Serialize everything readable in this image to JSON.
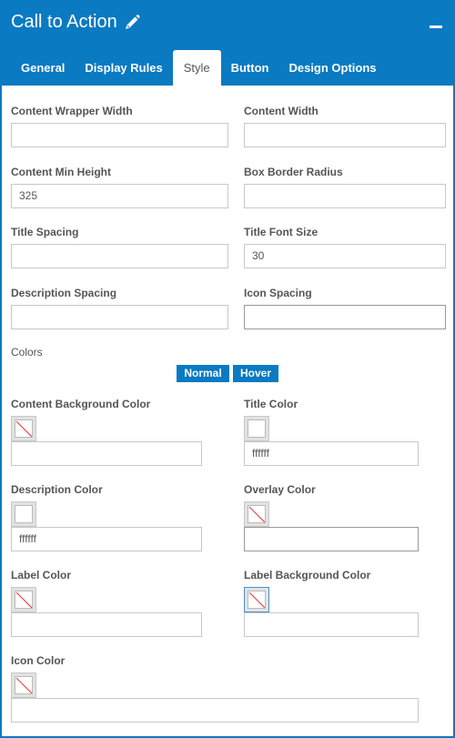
{
  "header": {
    "title": "Call to Action",
    "edit_icon": "pencil-icon",
    "minimize_icon": "minimize-icon"
  },
  "tabs": [
    {
      "label": "General",
      "active": false
    },
    {
      "label": "Display Rules",
      "active": false
    },
    {
      "label": "Style",
      "active": true
    },
    {
      "label": "Button",
      "active": false
    },
    {
      "label": "Design Options",
      "active": false
    }
  ],
  "fields": {
    "content_wrapper_width": {
      "label": "Content Wrapper Width",
      "value": ""
    },
    "content_width": {
      "label": "Content Width",
      "value": ""
    },
    "content_min_height": {
      "label": "Content Min Height",
      "value": "325"
    },
    "box_border_radius": {
      "label": "Box Border Radius",
      "value": ""
    },
    "title_spacing": {
      "label": "Title Spacing",
      "value": ""
    },
    "title_font_size": {
      "label": "Title Font Size",
      "value": "30"
    },
    "description_spacing": {
      "label": "Description Spacing",
      "value": ""
    },
    "icon_spacing": {
      "label": "Icon Spacing",
      "value": ""
    }
  },
  "colors": {
    "section_label": "Colors",
    "states": [
      {
        "label": "Normal",
        "active": true
      },
      {
        "label": "Hover",
        "active": false
      }
    ],
    "items": {
      "content_background_color": {
        "label": "Content Background Color",
        "value": "",
        "swatch": "none"
      },
      "title_color": {
        "label": "Title Color",
        "value": "ffffff",
        "swatch": "#ffffff"
      },
      "description_color": {
        "label": "Description Color",
        "value": "ffffff",
        "swatch": "#ffffff"
      },
      "overlay_color": {
        "label": "Overlay Color",
        "value": "",
        "swatch": "none"
      },
      "label_color": {
        "label": "Label Color",
        "value": "",
        "swatch": "none"
      },
      "label_background_color": {
        "label": "Label Background Color",
        "value": "",
        "swatch": "none"
      },
      "icon_color": {
        "label": "Icon Color",
        "value": "",
        "swatch": "none"
      }
    }
  },
  "theme": {
    "accent": "#0a7ac2",
    "no_color_slash": "#e8484a"
  }
}
